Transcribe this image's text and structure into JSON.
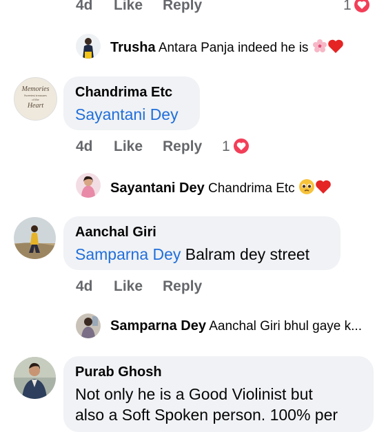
{
  "top_meta": {
    "time": "4d",
    "like": "Like",
    "reply": "Reply",
    "count": "1",
    "reaction_icon": "heart-react-icon"
  },
  "replies": [
    {
      "author": "Trusha",
      "mention": "Antara Panja",
      "text": " indeed he is",
      "emojis": [
        "cherry-blossom-icon",
        "red-heart-icon"
      ]
    },
    {
      "author": "Sayantani Dey",
      "mention": "Chandrima Etc",
      "text": "",
      "emojis": [
        "pleading-face-icon",
        "red-heart-icon"
      ]
    },
    {
      "author": "Samparna Dey",
      "mention": "",
      "text": "Aanchal Giri bhul gaye k..."
    }
  ],
  "comments": [
    {
      "author": "Chandrima Etc",
      "mention": "Sayantani Dey",
      "text": "",
      "avatar_text": [
        "Memories",
        "Sweetest treasures",
        "of the",
        "Heart"
      ],
      "meta": {
        "time": "4d",
        "like": "Like",
        "reply": "Reply",
        "count": "1",
        "reaction_icon": "heart-react-icon"
      }
    },
    {
      "author": "Aanchal Giri",
      "mention": "Samparna Dey",
      "text": " Balram dey street",
      "meta": {
        "time": "4d",
        "like": "Like",
        "reply": "Reply"
      }
    },
    {
      "author": "Purab Ghosh",
      "line1": "Not only he is a Good Violinist but",
      "line2": "also a Soft Spoken person. 100% per"
    }
  ],
  "colors": {
    "link": "#216fdb",
    "meta": "#65676b",
    "bubble": "#f0f2f5",
    "heart": "#f33e58"
  }
}
